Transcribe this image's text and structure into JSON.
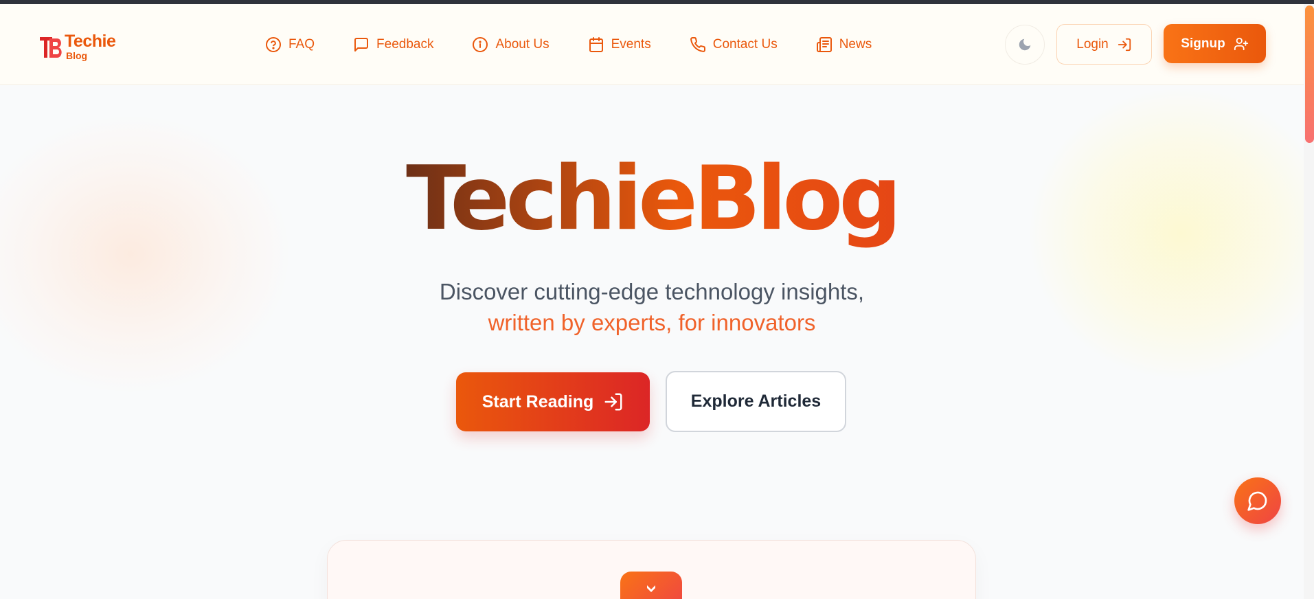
{
  "brand": {
    "title": "Techie",
    "subtitle": "Blog",
    "accent": "#ea580c",
    "accent_end": "#dc2626"
  },
  "nav": {
    "items": [
      {
        "label": "FAQ",
        "icon": "help-circle-icon"
      },
      {
        "label": "Feedback",
        "icon": "message-square-icon"
      },
      {
        "label": "About Us",
        "icon": "info-icon"
      },
      {
        "label": "Events",
        "icon": "calendar-icon"
      },
      {
        "label": "Contact Us",
        "icon": "phone-icon"
      },
      {
        "label": "News",
        "icon": "newspaper-icon"
      }
    ]
  },
  "header": {
    "theme_toggle_icon": "moon-icon",
    "login_label": "Login",
    "login_icon": "log-in-icon",
    "signup_label": "Signup",
    "signup_icon": "user-plus-icon"
  },
  "hero": {
    "title": "TechieBlog",
    "tagline_line1": "Discover cutting-edge technology insights,",
    "tagline_line2": "written by experts, for innovators",
    "primary_cta": "Start Reading",
    "primary_cta_icon": "log-in-icon",
    "secondary_cta": "Explore Articles"
  },
  "floating": {
    "chat_icon": "message-circle-icon"
  },
  "card": {
    "icon": "chevron-down-icon"
  }
}
